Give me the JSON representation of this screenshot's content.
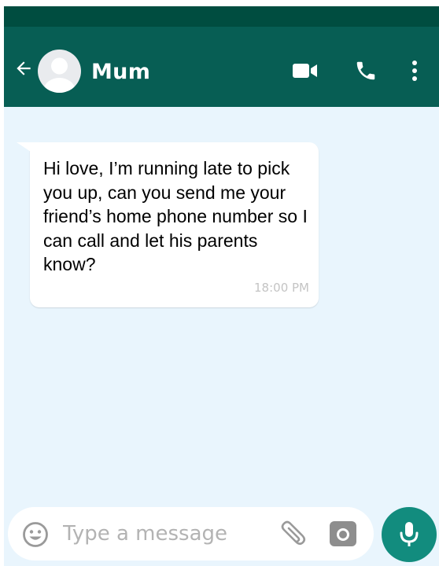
{
  "header": {
    "contact_name": "Mum",
    "icons": {
      "back": "arrow-left-icon",
      "avatar": "default-avatar",
      "video": "video-camera-icon",
      "call": "phone-icon",
      "menu": "more-vertical-icon"
    }
  },
  "messages": [
    {
      "text": "Hi love, I’m running late to pick you up, can you send me your friend’s home phone number so I can call and let his parents know?",
      "time": "18:00 PM",
      "direction": "incoming"
    }
  ],
  "composer": {
    "placeholder": "Type a message",
    "value": "",
    "icons": {
      "emoji": "smiley-icon",
      "attach": "paperclip-icon",
      "camera": "camera-icon",
      "mic": "microphone-icon"
    }
  },
  "colors": {
    "status_bar": "#004d40",
    "app_bar": "#075e54",
    "chat_background": "#e9f5fd",
    "bubble": "#ffffff",
    "mic_button": "#128c7e",
    "timestamp": "#c4c4c4"
  }
}
